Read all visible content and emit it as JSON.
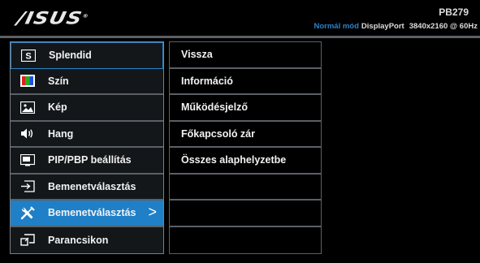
{
  "header": {
    "brand": "/ISUS",
    "brand_tm": "®",
    "model": "PB279",
    "status": {
      "mode": "Normál mód",
      "input": "DisplayPort",
      "resolution": "3840x2160 @ 60Hz"
    }
  },
  "left_menu": {
    "items": [
      {
        "label": "Splendid",
        "icon": "s-icon"
      },
      {
        "label": "Szín",
        "icon": "color-icon"
      },
      {
        "label": "Kép",
        "icon": "image-icon"
      },
      {
        "label": "Hang",
        "icon": "speaker-icon"
      },
      {
        "label": "PIP/PBP beállítás",
        "icon": "pip-icon"
      },
      {
        "label": "Bemenetválasztás",
        "icon": "input-icon"
      },
      {
        "label": "Bemenetválasztás",
        "icon": "tools-icon",
        "chevron": ">"
      },
      {
        "label": "Parancsikon",
        "icon": "shortcut-icon"
      }
    ]
  },
  "right_menu": {
    "items": [
      {
        "label": "Vissza"
      },
      {
        "label": "Információ"
      },
      {
        "label": "Működésjelző"
      },
      {
        "label": "Főkapcsoló zár"
      },
      {
        "label": "Összes alaphelyzetbe"
      },
      {
        "label": ""
      },
      {
        "label": ""
      },
      {
        "label": ""
      }
    ]
  },
  "colors": {
    "accent": "#1f7fc7",
    "mode_text": "#2b83c9",
    "divider": "#5a6066"
  }
}
